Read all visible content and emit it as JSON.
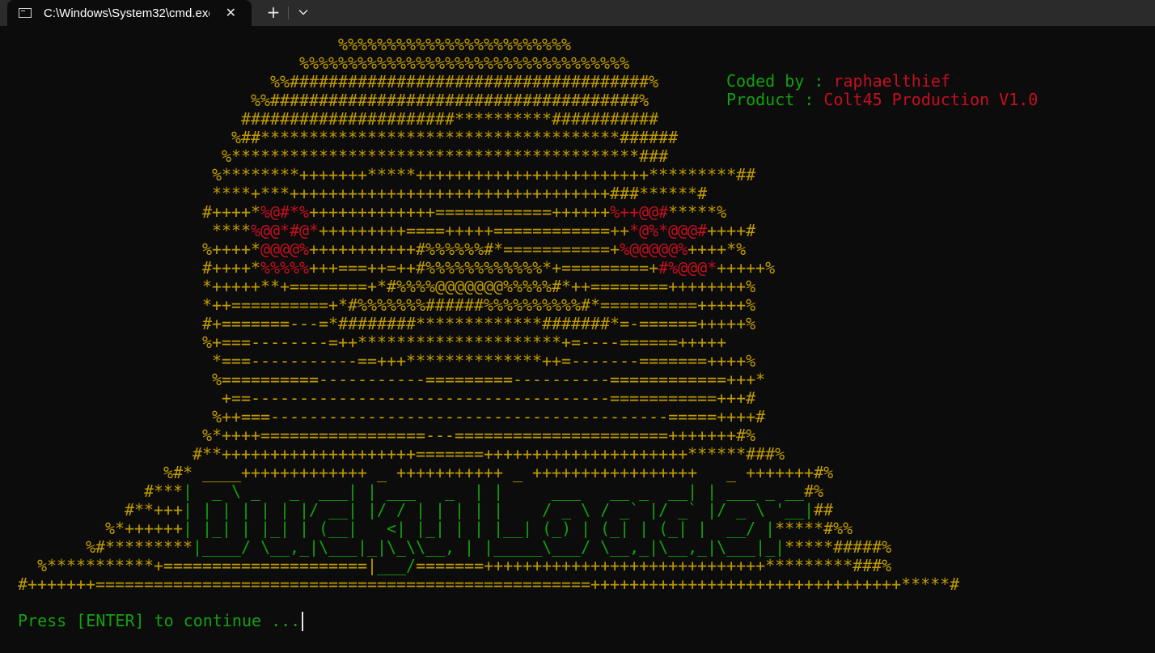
{
  "window": {
    "tab_title": "C:\\Windows\\System32\\cmd.exe",
    "tab_icon": "terminal-icon",
    "close_icon": "close-icon",
    "new_tab_icon": "plus-icon",
    "dropdown_icon": "chevron-down-icon"
  },
  "info": {
    "coded_label": "Coded by : ",
    "coded_value": "raphaelthief",
    "product_label": "Product : ",
    "product_value": "Colt45 Production V1.0"
  },
  "prompt": "Press [ENTER] to continue ...",
  "colors": {
    "background": "#0c0c0c",
    "yellow": "#c19c00",
    "red": "#c50f1f",
    "green": "#13a10e"
  },
  "ascii_art": [
    [
      [
        "y",
        "                                 %%%%%%%%%%%%%%%%%%%%%%%%"
      ]
    ],
    [
      [
        "y",
        "                             %%%%%%%%%%%%%%%%%%%%%%%%%%%%%%%%%%"
      ]
    ],
    [
      [
        "y",
        "                          %%#####################################%"
      ]
    ],
    [
      [
        "y",
        "                        %%######################################%"
      ]
    ],
    [
      [
        "y",
        "                       ######################**********###########"
      ]
    ],
    [
      [
        "y",
        "                      %##*************************************######"
      ]
    ],
    [
      [
        "y",
        "                     %******************************************###"
      ]
    ],
    [
      [
        "y",
        "                    %********+++++++*****++++++++++++++++++++++++*********##"
      ]
    ],
    [
      [
        "y",
        "                    ****+***+++++++++++++++++++++++++++++++++###******#"
      ]
    ],
    [
      [
        "y",
        "                   #++++*"
      ],
      [
        "r",
        "%@#*%"
      ],
      [
        "y",
        "+++++++++++++============++++++"
      ],
      [
        "r",
        "%++@@#"
      ],
      [
        "y",
        "*****%"
      ]
    ],
    [
      [
        "y",
        "                    ****"
      ],
      [
        "r",
        "%@@*#@*"
      ],
      [
        "y",
        "+++++++++====+++++============++"
      ],
      [
        "r",
        "*@%*@@@#"
      ],
      [
        "y",
        "++++#"
      ]
    ],
    [
      [
        "y",
        "                   %++++*"
      ],
      [
        "r",
        "@@@@%"
      ],
      [
        "y",
        "+++++++++++#%%%%%%#*===========+"
      ],
      [
        "r",
        "%@@@@@%"
      ],
      [
        "y",
        "++++*%"
      ]
    ],
    [
      [
        "y",
        "                   #++++*"
      ],
      [
        "r",
        "%%%%%"
      ],
      [
        "y",
        "+++===++=++#%%%%%%%%%%%%*+=========+"
      ],
      [
        "r",
        "#%@@@*"
      ],
      [
        "y",
        "+++++%"
      ]
    ],
    [
      [
        "y",
        "                   *+++++**+========+*#%%%%@@@@@@@%%%%%#*++========++++++++%"
      ]
    ],
    [
      [
        "y",
        "                   *++==========+*#%%%%%%%######%%%%%%%%%%#*==========+++++%"
      ]
    ],
    [
      [
        "y",
        "                   #+=======---=*########*************#######*=-======+++++%"
      ]
    ],
    [
      [
        "y",
        "                   %+===--------=++*********************+=----======+++++"
      ]
    ],
    [
      [
        "y",
        "                    *===-----------==+++**************++=-------=======++++%"
      ]
    ],
    [
      [
        "y",
        "                    %==========-----------=========----------============+++*"
      ]
    ],
    [
      [
        "y",
        "                     +==-------------------------------------===========+++#"
      ]
    ],
    [
      [
        "y",
        "                    %++===-----------------------------------------=====++++#"
      ]
    ],
    [
      [
        "y",
        "                   %*++++=================---======================+++++++#%"
      ]
    ],
    [
      [
        "y",
        "                  #**++++++++++++++++++++=======+++++++++++++++++++++******###%"
      ]
    ],
    [
      [
        "y",
        "               %#* ____+++++++++++++ _ +++++++++++ _ +++++++++++++++++   _ +++++++#%"
      ]
    ],
    [
      [
        "y",
        "             #***"
      ],
      [
        "g",
        "|  _ \\ _   _  ___| | ___   _  | |     ___   __ _  __| | ___ _ __"
      ],
      [
        "y",
        "#%"
      ]
    ],
    [
      [
        "y",
        "           #**+++"
      ],
      [
        "g",
        "| | | | | | |/ __| |/ / | | | | |    / _ \\ / _` |/ _` |/ _ \\ '__|"
      ],
      [
        "y",
        "##"
      ]
    ],
    [
      [
        "y",
        "         %*++++++"
      ],
      [
        "g",
        "| |_| | |_| | (__|   <| |_| | | |__| (_) | (_| | (_| |  __/ |"
      ],
      [
        "y",
        "*****#%%"
      ]
    ],
    [
      [
        "y",
        "       %#*********"
      ],
      [
        "g",
        "|____/ \\__,_|\\___|_|\\_\\\\__, | |_____\\___/ \\__,_|\\__,_|\\___|_|"
      ],
      [
        "y",
        "*****#####%"
      ]
    ],
    [
      [
        "y",
        "  %***********+=====================|"
      ],
      [
        "g",
        "___/"
      ],
      [
        "y",
        "=======+++++++++++++++++++++++++++++*********###%"
      ]
    ],
    [
      [
        "y",
        "#+++++++===================================================++++++++++++++++++++++++++++++++*****#"
      ]
    ]
  ]
}
